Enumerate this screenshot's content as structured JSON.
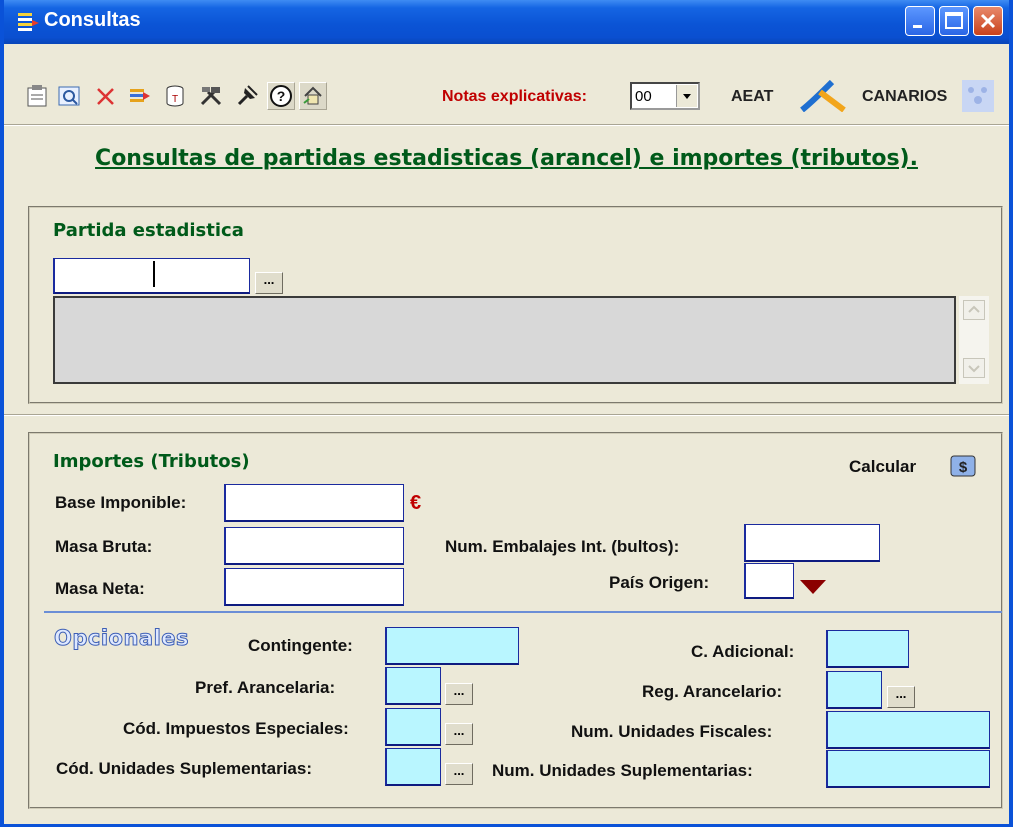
{
  "window": {
    "title": "Consultas"
  },
  "toolbar": {
    "notas_label": "Notas explicativas:",
    "notas_value": "00",
    "aeat_label": "AEAT",
    "canarios_label": "CANARIOS",
    "tools": [
      "properties-icon",
      "preview-icon",
      "delete-icon",
      "export-icon",
      "database-icon",
      "tools-icon",
      "help-icon",
      "home-icon"
    ]
  },
  "heading": "Consultas de partidas estadisticas (arancel) e importes (tributos).",
  "partida": {
    "label": "Partida estadistica",
    "code_value": "",
    "browse_label": "..."
  },
  "importes": {
    "label": "Importes (Tributos)",
    "calcular_label": "Calcular",
    "base_imponible_label": "Base Imponible:",
    "currency_symbol": "€",
    "masa_bruta_label": "Masa Bruta:",
    "masa_neta_label": "Masa Neta:",
    "num_embalajes_label": "Num. Embalajes Int. (bultos):",
    "pais_origen_label": "País Origen:"
  },
  "opcionales": {
    "label": "Opcionales",
    "contingente_label": "Contingente:",
    "pref_arancelaria_label": "Pref. Arancelaria:",
    "cod_impuestos_label": "Cód. Impuestos Especiales:",
    "cod_unidades_label": "Cód. Unidades Suplementarias:",
    "c_adicional_label": "C. Adicional:",
    "reg_arancelario_label": "Reg. Arancelario:",
    "num_unidades_fiscales_label": "Num. Unidades Fiscales:",
    "num_unidades_supl_label": "Num. Unidades Suplementarias:",
    "browse_label": "..."
  },
  "colors": {
    "titlebar": "#0a52d8",
    "heading_green": "#005a1a",
    "accent_red": "#c00000",
    "optional_field": "#b9f6ff"
  }
}
